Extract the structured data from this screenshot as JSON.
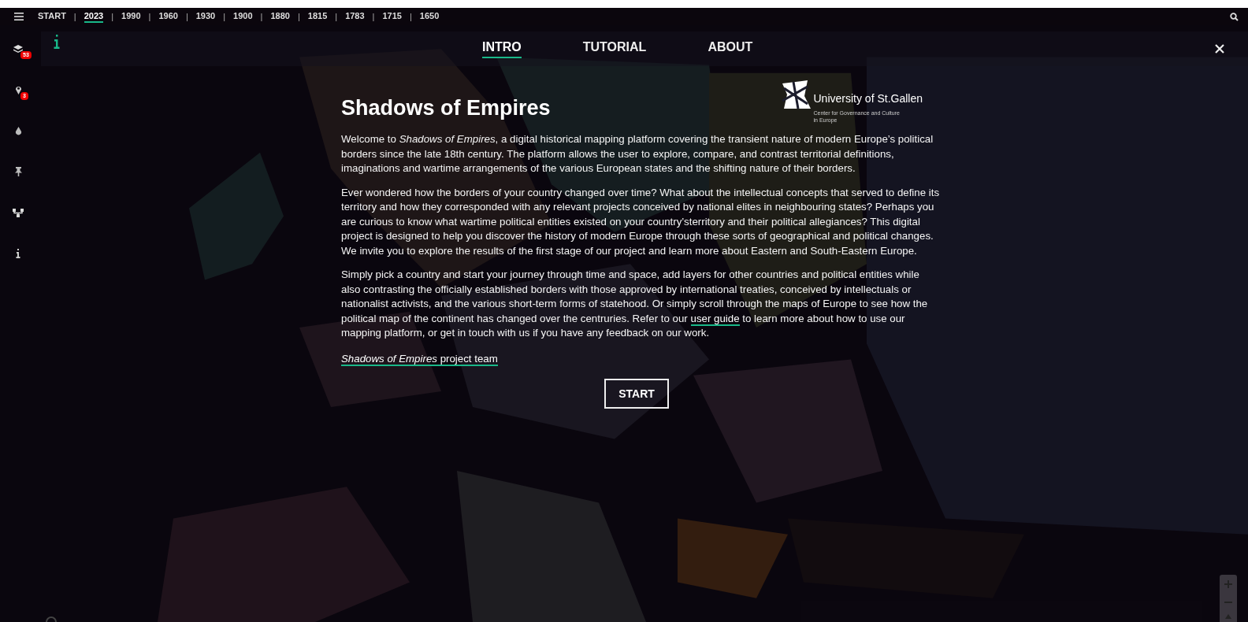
{
  "timeline": {
    "start": "START",
    "years": [
      {
        "label": "2023",
        "selected": true
      },
      {
        "label": "1990",
        "selected": false
      },
      {
        "label": "1960",
        "selected": false
      },
      {
        "label": "1930",
        "selected": false
      },
      {
        "label": "1900",
        "selected": false
      },
      {
        "label": "1880",
        "selected": false
      },
      {
        "label": "1815",
        "selected": false
      },
      {
        "label": "1783",
        "selected": false
      },
      {
        "label": "1715",
        "selected": false
      },
      {
        "label": "1650",
        "selected": false
      }
    ],
    "separator": "|"
  },
  "sidebar": {
    "items": [
      {
        "kind": "layers",
        "badge": "53"
      },
      {
        "kind": "pin",
        "badge": "3"
      },
      {
        "kind": "drop"
      },
      {
        "kind": "pushpin"
      },
      {
        "kind": "network"
      },
      {
        "kind": "info"
      }
    ]
  },
  "tabs": [
    {
      "label": "INTRO",
      "selected": true
    },
    {
      "label": "TUTORIAL",
      "selected": false
    },
    {
      "label": "ABOUT",
      "selected": false
    }
  ],
  "intro": {
    "title": "Shadows of Empires",
    "logo": {
      "name": "University of St.Gallen",
      "subtitle": "Center for Governance and Culture in Europe"
    },
    "paragraphs": [
      {
        "text": "Welcome to *Shadows of Empires*, a digital historical mapping platform covering the transient nature of modern Europe’s political borders since the late 18th century. The platform allows the user to explore, compare, and contrast territorial definitions, imaginations and wartime arrangements of the various European states and the shifting nature of their borders."
      },
      {
        "text": "Ever wondered how the borders of your country changed over time? What about the intellectual concepts that served to define its territory and how they corresponded with any relevant projects conceived by national elites in neighbouring states? Perhaps you are curious to know what wartime political entities existed on your country’sterritory and their political allegiances? This digital project is designed to help you discover the history of modern Europe through these sorts of geographical and political changes. We invite you to explore the results of the first stage of our project and learn more about Eastern and South-Eastern Europe."
      },
      {
        "before": "Simply pick a country and start your journey through time and space, add layers for other countries and political entities while also contrasting the officially established borders with those approved by international treaties, conceived by intellectuals or nationalist activists, and the various short-term forms of statehood. Or simply scroll through the maps of Europe to see how the political map of the continent has changed over the centruries. Refer to our",
        "link": "user guide",
        "after": "to learn more about how to use our mapping platform, or get in touch with us if you have any feedback on our work."
      }
    ],
    "signature": "*Shadows of Empires* project team",
    "button": "START"
  }
}
